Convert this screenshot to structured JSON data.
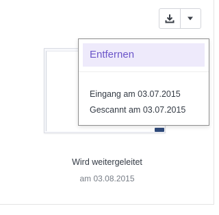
{
  "toolbar": {
    "download_icon": "download-icon",
    "more_icon": "caret-down-icon"
  },
  "menu": {
    "remove_label": "Entfernen",
    "received_text": "Eingang am 03.07.2015",
    "scanned_text": "Gescannt am 03.07.2015"
  },
  "document": {
    "status": "Wird weitergeleitet",
    "status_date": "am 03.08.2015"
  },
  "colors": {
    "accent": "#6b55c9",
    "menu_highlight": "#eeeafb",
    "text": "#333a44",
    "muted_text": "#777d86"
  }
}
